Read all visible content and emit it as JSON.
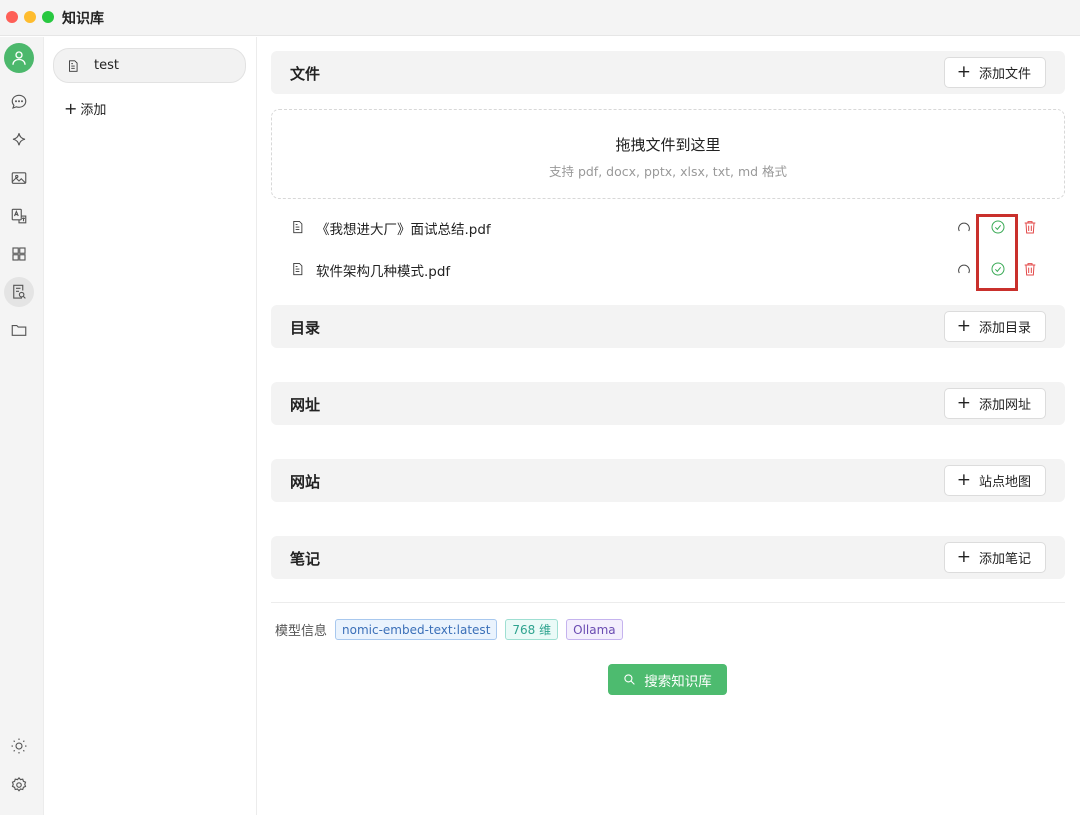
{
  "window": {
    "title": "知识库"
  },
  "kb_list": {
    "items": [
      {
        "label": "test",
        "icon": "document-icon"
      }
    ],
    "add_label": "添加"
  },
  "sections": {
    "files": {
      "title": "文件",
      "button_label": "添加文件"
    },
    "dropzone": {
      "title": "拖拽文件到这里",
      "subtitle": "支持 pdf, docx, pptx, xlsx, txt, md 格式"
    },
    "file_items": [
      {
        "name": "《我想进大厂》面试总结.pdf",
        "status": "processed"
      },
      {
        "name": "软件架构几种模式.pdf",
        "status": "processed"
      }
    ],
    "directories": {
      "title": "目录",
      "button_label": "添加目录"
    },
    "urls": {
      "title": "网址",
      "button_label": "添加网址"
    },
    "websites": {
      "title": "网站",
      "button_label": "站点地图"
    },
    "notes": {
      "title": "笔记",
      "button_label": "添加笔记"
    }
  },
  "model_info": {
    "label": "模型信息",
    "model": "nomic-embed-text:latest",
    "dimensions": "768 维",
    "provider": "Ollama"
  },
  "search_button": {
    "label": "搜索知识库"
  },
  "colors": {
    "accent_green": "#4dbb6f",
    "success_green": "#3aaa56",
    "delete_red": "#e34949",
    "highlight_red": "#c9302c"
  }
}
